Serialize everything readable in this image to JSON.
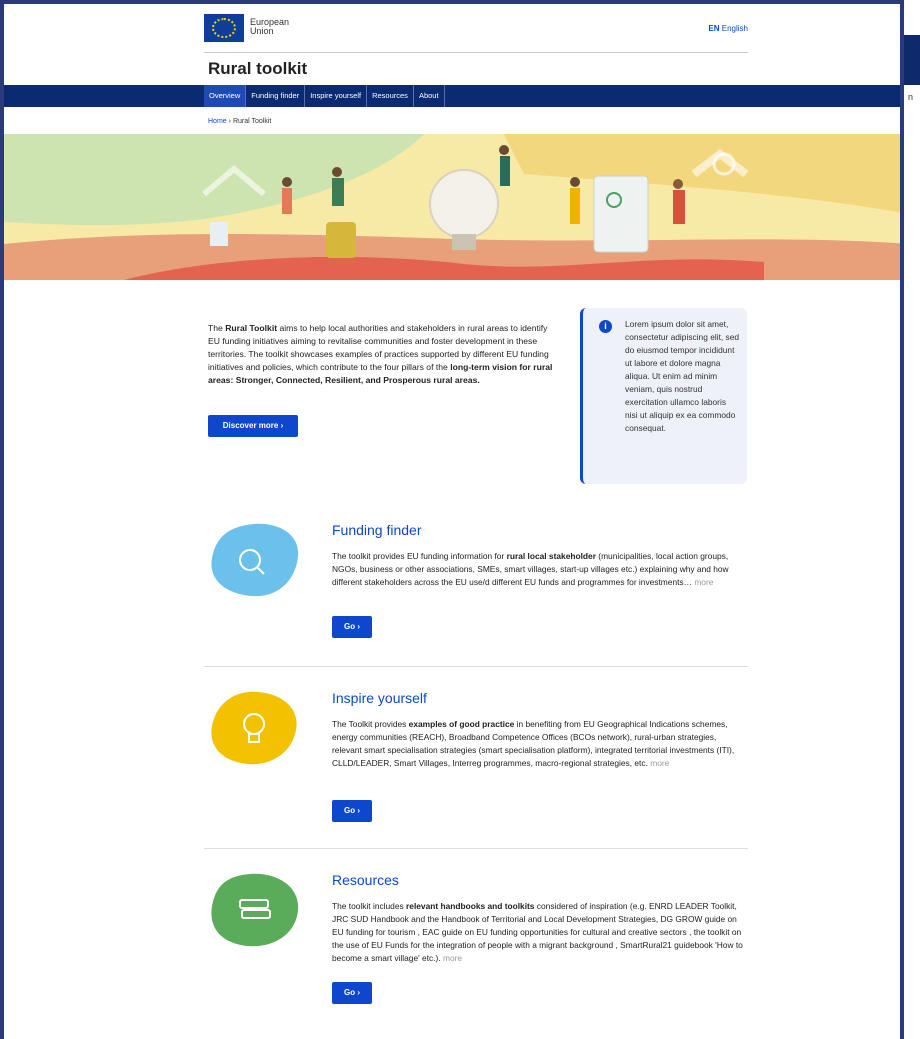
{
  "header": {
    "eu_line1": "European",
    "eu_line2": "Union",
    "lang_code": "EN",
    "lang_name": "English"
  },
  "site_title": "Rural toolkit",
  "nav": [
    "Overview",
    "Funding finder",
    "Inspire yourself",
    "Resources",
    "About"
  ],
  "breadcrumb": {
    "home": "Home",
    "sep": "›",
    "current": "Rural Toolkit"
  },
  "intro": {
    "p1_a": "The ",
    "p1_b": "Rural Toolkit",
    "p1_c": " aims to help local authorities and stakeholders in rural areas to identify EU funding initiatives aiming to revitalise communities and foster development in these territories. The toolkit showcases examples of practices supported by different EU funding initiatives and policies, which contribute to the four pillars of the ",
    "p1_d": "long-term vision for rural areas: Stronger, Connected, Resilient, and Prosperous rural areas.",
    "button": "Discover more ›"
  },
  "infobox": {
    "text": "Lorem ipsum dolor sit amet, consectetur adipiscing elit, sed do eiusmod tempor incididunt ut labore et dolore magna aliqua. Ut enim ad minim veniam, quis nostrud exercitation ullamco laboris nisi ut aliquip ex ea commodo consequat."
  },
  "sections": [
    {
      "title": "Funding finder",
      "a": "The toolkit provides EU funding information for ",
      "b": "rural local stakeholder",
      "c": " (municipalities, local action groups, NGOs, business or other associations, SMEs, smart villages, start-up villages etc.) explaining why and how different stakeholders across the EU use/d different EU funds and programmes for investments…",
      "more": "more",
      "button": "Go ›",
      "color": "#6cc1ec"
    },
    {
      "title": "Inspire yourself",
      "a": "The Toolkit provides ",
      "b": "examples of good practice",
      "c": " in benefiting from EU Geographical Indications schemes, energy communities (REACH), Broadband Competence Offices (BCOs network), rural-urban strategies, relevant smart specialisation strategies (smart specialisation platform), integrated territorial investments (ITI), CLLD/LEADER, Smart Villages, Interreg programmes, macro-regional strategies, etc.",
      "more": "more",
      "button": "Go ›",
      "color": "#f2c200"
    },
    {
      "title": "Resources",
      "a": "The toolkit includes ",
      "b": "relevant handbooks and toolkits",
      "c": " considered of inspiration (e.g. ENRD LEADER Toolkit, JRC SUD Handbook and the Handbook of Territorial and Local Development Strategies, DG GROW guide on EU funding for tourism , EAC guide on EU funding opportunities for cultural and creative sectors , the toolkit on the use of EU Funds for the integration of people with a migrant background , SmartRural21 guidebook 'How to become a smart village'  etc.).",
      "more": "more",
      "button": "Go ›",
      "color": "#5aab5a"
    }
  ],
  "right_strip_label": "n"
}
